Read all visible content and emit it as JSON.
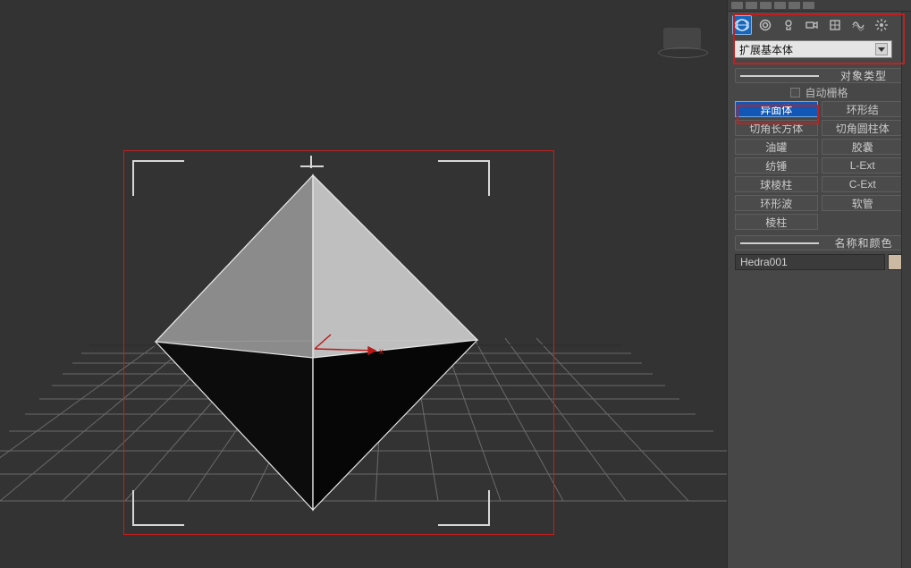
{
  "panel": {
    "dropdown_label": "扩展基本体",
    "rollout_object_type": "对象类型",
    "autogrid_label": "自动栅格",
    "buttons": [
      {
        "label": "异面体",
        "active": true
      },
      {
        "label": "环形结",
        "active": false
      },
      {
        "label": "切角长方体",
        "active": false
      },
      {
        "label": "切角圆柱体",
        "active": false
      },
      {
        "label": "油罐",
        "active": false
      },
      {
        "label": "胶囊",
        "active": false
      },
      {
        "label": "纺锤",
        "active": false
      },
      {
        "label": "L-Ext",
        "active": false
      },
      {
        "label": "球棱柱",
        "active": false
      },
      {
        "label": "C-Ext",
        "active": false
      },
      {
        "label": "环形波",
        "active": false
      },
      {
        "label": "软管",
        "active": false
      },
      {
        "label": "棱柱",
        "active": false
      }
    ],
    "rollout_name_color": "名称和颜色",
    "object_name": "Hedra001",
    "object_color": "#cbb9a2",
    "gizmo_axis_label": "x"
  }
}
